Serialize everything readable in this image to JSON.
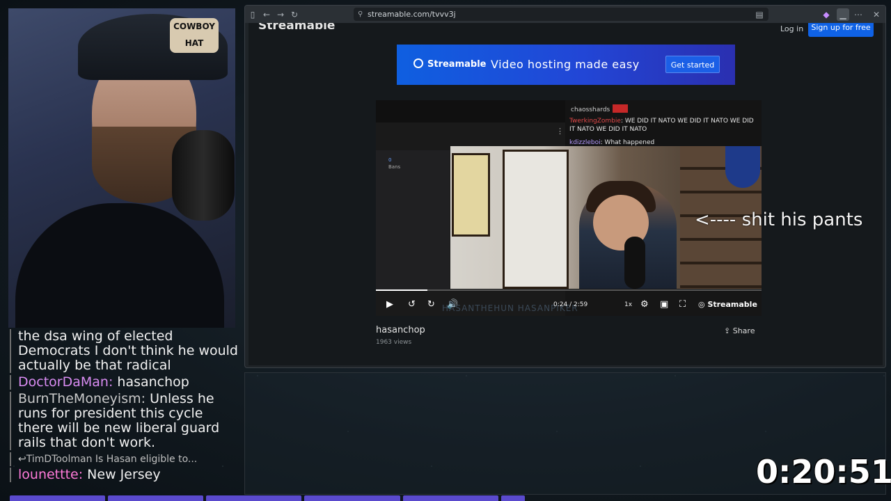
{
  "browser": {
    "url": "streamable.com/tvvv3j"
  },
  "site": {
    "brand": "Streamable",
    "login": "Log in",
    "signup": "Sign up for free"
  },
  "ad": {
    "logo": "Streamable",
    "tagline": "Video hosting made easy",
    "cta": "Get started"
  },
  "video": {
    "embedded_chat": [
      {
        "user": "chaosshards",
        "text": ""
      },
      {
        "user": "TwerkingZombie",
        "text": "WE DID IT NATO WE DID IT NATO WE DID IT NATO WE DID IT NATO"
      },
      {
        "user": "kdizzleboi",
        "text": "What happened"
      }
    ],
    "side_panel_count": "0",
    "side_panel_label": "Bans",
    "time": "0:24 / 2:59",
    "progress_fraction": 0.134,
    "rate": "1x",
    "brand": "Streamable",
    "watermark": "HASANTHEHUN HASANPIKER",
    "title": "hasanchop",
    "views": "1963 views",
    "share": "Share"
  },
  "overlay": {
    "caption": "<---- shit his pants",
    "timer": "0:20:51"
  },
  "chat": {
    "messages": [
      {
        "user": "",
        "text": "the dsa wing of elected Democrats I don't think he would actually be that radical",
        "color": "#f2f2f2"
      },
      {
        "user": "DoctorDaMan",
        "text": "hasanchop",
        "color": "#d98cf2"
      },
      {
        "user": "BurnTheMoneyism",
        "text": "Unless he runs for president this cycle there will be new liberal guard rails that don't work.",
        "color": "#c9c9c9"
      },
      {
        "reply_to": "↩TimDToolman Is Hasan eligible to..."
      },
      {
        "user": "lounettte",
        "text": "New Jersey",
        "color": "#ff7ad9"
      }
    ]
  },
  "webcam": {
    "cap_text": "COWBOY HAT"
  }
}
